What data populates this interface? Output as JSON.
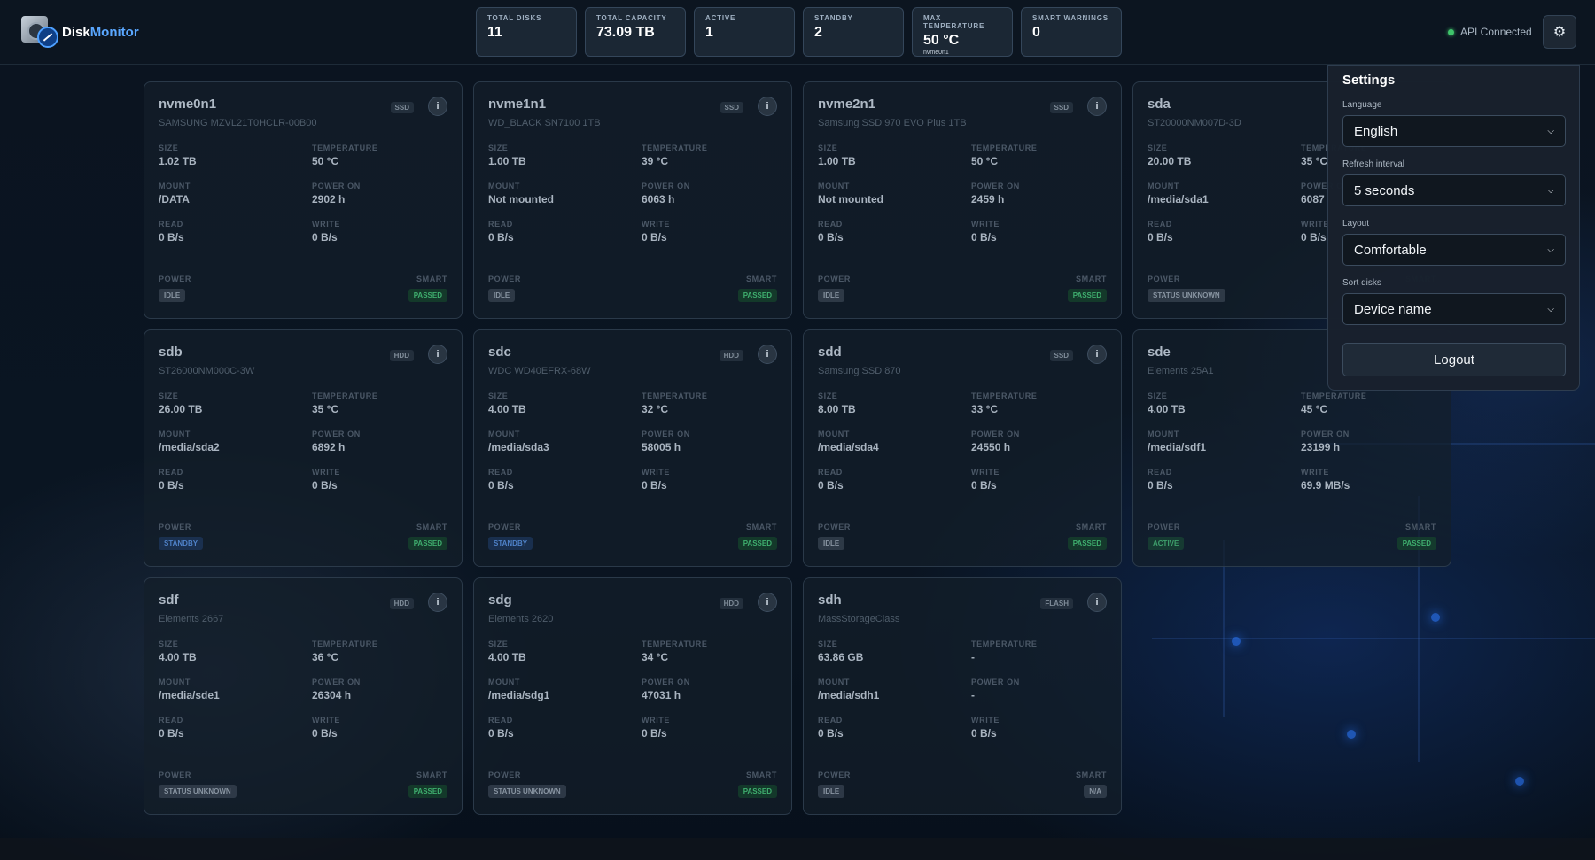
{
  "app": {
    "brand_primary": "Disk",
    "brand_accent": "Monitor"
  },
  "stats": [
    {
      "label": "TOTAL DISKS",
      "value": "11",
      "sub": ""
    },
    {
      "label": "TOTAL CAPACITY",
      "value": "73.09 TB",
      "sub": ""
    },
    {
      "label": "ACTIVE",
      "value": "1",
      "sub": ""
    },
    {
      "label": "STANDBY",
      "value": "2",
      "sub": ""
    },
    {
      "label": "MAX TEMPERATURE",
      "value": "50 °C",
      "sub": "nvme0n1"
    },
    {
      "label": "SMART WARNINGS",
      "value": "0",
      "sub": ""
    }
  ],
  "api_status": "API Connected",
  "field_labels": {
    "size": "SIZE",
    "temperature": "TEMPERATURE",
    "mount": "MOUNT",
    "power_on": "POWER ON",
    "read": "READ",
    "write": "WRITE",
    "power": "POWER",
    "smart": "SMART"
  },
  "disks": [
    {
      "name": "nvme0n1",
      "model": "SAMSUNG MZVL21T0HCLR-00B00",
      "type": "SSD",
      "size": "1.02 TB",
      "temp": "50 °C",
      "mount": "/DATA",
      "power_on": "2902 h",
      "read": "0 B/s",
      "write": "0 B/s",
      "power": "IDLE",
      "power_kind": "neutral",
      "smart": "PASSED",
      "smart_kind": "passed"
    },
    {
      "name": "nvme1n1",
      "model": "WD_BLACK SN7100 1TB",
      "type": "SSD",
      "size": "1.00 TB",
      "temp": "39 °C",
      "mount": "Not mounted",
      "power_on": "6063 h",
      "read": "0 B/s",
      "write": "0 B/s",
      "power": "IDLE",
      "power_kind": "neutral",
      "smart": "PASSED",
      "smart_kind": "passed"
    },
    {
      "name": "nvme2n1",
      "model": "Samsung SSD 970 EVO Plus 1TB",
      "type": "SSD",
      "size": "1.00 TB",
      "temp": "50 °C",
      "mount": "Not mounted",
      "power_on": "2459 h",
      "read": "0 B/s",
      "write": "0 B/s",
      "power": "IDLE",
      "power_kind": "neutral",
      "smart": "PASSED",
      "smart_kind": "passed"
    },
    {
      "name": "sda",
      "model": "ST20000NM007D-3D",
      "type": "",
      "size": "20.00 TB",
      "temp": "35 °C",
      "mount": "/media/sda1",
      "power_on": "6087",
      "read": "0 B/s",
      "write": "0 B/s",
      "power": "STATUS UNKNOWN",
      "power_kind": "neutral",
      "smart": "",
      "smart_kind": "passed"
    },
    {
      "name": "sdb",
      "model": "ST26000NM000C-3W",
      "type": "HDD",
      "size": "26.00 TB",
      "temp": "35 °C",
      "mount": "/media/sda2",
      "power_on": "6892 h",
      "read": "0 B/s",
      "write": "0 B/s",
      "power": "STANDBY",
      "power_kind": "standby",
      "smart": "PASSED",
      "smart_kind": "passed"
    },
    {
      "name": "sdc",
      "model": "WDC WD40EFRX-68W",
      "type": "HDD",
      "size": "4.00 TB",
      "temp": "32 °C",
      "mount": "/media/sda3",
      "power_on": "58005 h",
      "read": "0 B/s",
      "write": "0 B/s",
      "power": "STANDBY",
      "power_kind": "standby",
      "smart": "PASSED",
      "smart_kind": "passed"
    },
    {
      "name": "sdd",
      "model": "Samsung SSD 870",
      "type": "SSD",
      "size": "8.00 TB",
      "temp": "33 °C",
      "mount": "/media/sda4",
      "power_on": "24550 h",
      "read": "0 B/s",
      "write": "0 B/s",
      "power": "IDLE",
      "power_kind": "neutral",
      "smart": "PASSED",
      "smart_kind": "passed"
    },
    {
      "name": "sde",
      "model": "Elements 25A1",
      "type": "",
      "size": "4.00 TB",
      "temp": "45 °C",
      "mount": "/media/sdf1",
      "power_on": "23199 h",
      "read": "0 B/s",
      "write": "69.9 MB/s",
      "power": "ACTIVE",
      "power_kind": "active",
      "smart": "PASSED",
      "smart_kind": "passed"
    },
    {
      "name": "sdf",
      "model": "Elements 2667",
      "type": "HDD",
      "size": "4.00 TB",
      "temp": "36 °C",
      "mount": "/media/sde1",
      "power_on": "26304 h",
      "read": "0 B/s",
      "write": "0 B/s",
      "power": "STATUS UNKNOWN",
      "power_kind": "neutral",
      "smart": "PASSED",
      "smart_kind": "passed"
    },
    {
      "name": "sdg",
      "model": "Elements 2620",
      "type": "HDD",
      "size": "4.00 TB",
      "temp": "34 °C",
      "mount": "/media/sdg1",
      "power_on": "47031 h",
      "read": "0 B/s",
      "write": "0 B/s",
      "power": "STATUS UNKNOWN",
      "power_kind": "neutral",
      "smart": "PASSED",
      "smart_kind": "passed"
    },
    {
      "name": "sdh",
      "model": "MassStorageClass",
      "type": "FLASH",
      "size": "63.86 GB",
      "temp": "-",
      "mount": "/media/sdh1",
      "power_on": "-",
      "read": "0 B/s",
      "write": "0 B/s",
      "power": "IDLE",
      "power_kind": "neutral",
      "smart": "N/A",
      "smart_kind": "neutral"
    }
  ],
  "settings": {
    "title": "Settings",
    "language_label": "Language",
    "language_value": "English",
    "refresh_label": "Refresh interval",
    "refresh_value": "5 seconds",
    "layout_label": "Layout",
    "layout_value": "Comfortable",
    "sort_label": "Sort disks",
    "sort_value": "Device name",
    "logout_label": "Logout"
  },
  "colors": {
    "accent": "#5aa7ff",
    "connected": "#3fc46b",
    "passed": "#3fae6e",
    "standby": "#4f82c8"
  }
}
